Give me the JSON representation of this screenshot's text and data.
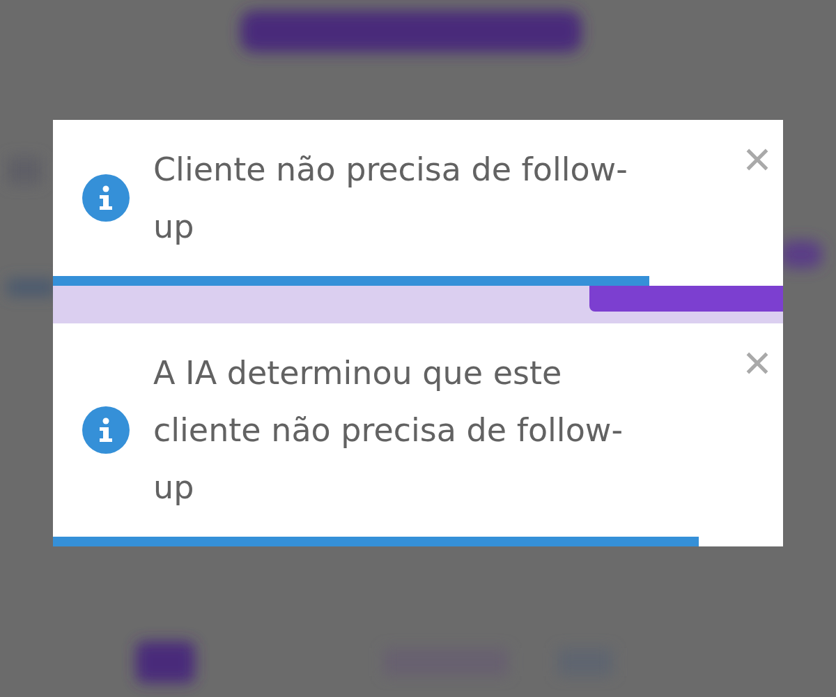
{
  "toasts": [
    {
      "kind": "info",
      "message": "Cliente não precisa de follow-up",
      "level": 0.817
    },
    {
      "kind": "info",
      "message": "A IA determinou que este cliente não precisa de follow-up",
      "level": 0.885
    }
  ]
}
